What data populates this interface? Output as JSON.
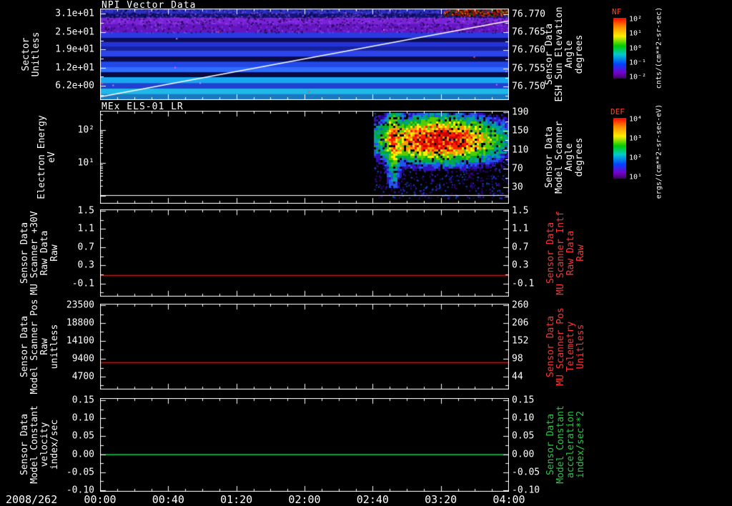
{
  "chart_data": [
    {
      "id": "npi-sector-spectrogram",
      "type": "heatmap",
      "title": "NPI Vector Data",
      "left_label": "Sector\nUnitless",
      "left_ticks": [
        {
          "label": "3.1e+01",
          "pos": 0.054
        },
        {
          "label": "2.5e+01",
          "pos": 0.254
        },
        {
          "label": "1.9e+01",
          "pos": 0.446
        },
        {
          "label": "1.2e+01",
          "pos": 0.646
        },
        {
          "label": "6.2e+00",
          "pos": 0.846
        }
      ],
      "right_label": "Sensor Data\nESH Sun Elevation\nAngle\ndegrees",
      "right_label_color": "#ffffff",
      "right_ticks": [
        {
          "label": "76.770",
          "pos": 0.06
        },
        {
          "label": "76.765",
          "pos": 0.26
        },
        {
          "label": "76.760",
          "pos": 0.454
        },
        {
          "label": "76.755",
          "pos": 0.654
        },
        {
          "label": "76.750",
          "pos": 0.854
        }
      ],
      "overlay_line": {
        "name": "ESH Sun Elevation Angle",
        "color": "#ffffff",
        "value_start": 76.748,
        "value_end": 76.77,
        "pos_start": 0.965,
        "pos_end": 0.135
      },
      "bands": [
        {
          "y0": 0.0,
          "y1": 0.055,
          "color": "#2830c0",
          "noise": true
        },
        {
          "y0": 0.055,
          "y1": 0.1,
          "color": "#141478",
          "noise": true
        },
        {
          "y0": 0.1,
          "y1": 0.17,
          "color": "#7a22d8",
          "noise": true
        },
        {
          "y0": 0.17,
          "y1": 0.26,
          "color": "#6414c0",
          "noise": true
        },
        {
          "y0": 0.26,
          "y1": 0.32,
          "color": "#2a3ae0",
          "noise": false
        },
        {
          "y0": 0.32,
          "y1": 0.365,
          "color": "#0c0c55",
          "noise": false
        },
        {
          "y0": 0.365,
          "y1": 0.415,
          "color": "#2334d6",
          "noise": false
        },
        {
          "y0": 0.415,
          "y1": 0.46,
          "color": "#18219c",
          "noise": false
        },
        {
          "y0": 0.46,
          "y1": 0.525,
          "color": "#2c44e8",
          "noise": false
        },
        {
          "y0": 0.525,
          "y1": 0.58,
          "color": "#0b0b46",
          "noise": false
        },
        {
          "y0": 0.58,
          "y1": 0.64,
          "color": "#2348e8",
          "noise": false
        },
        {
          "y0": 0.64,
          "y1": 0.695,
          "color": "#2f6cff",
          "noise": false
        },
        {
          "y0": 0.695,
          "y1": 0.75,
          "color": "#0a0a40",
          "noise": false
        },
        {
          "y0": 0.75,
          "y1": 0.815,
          "color": "#18a8f0",
          "noise": false
        },
        {
          "y0": 0.815,
          "y1": 0.875,
          "color": "#2040d0",
          "noise": false
        },
        {
          "y0": 0.875,
          "y1": 0.935,
          "color": "#20b8e8",
          "noise": false
        },
        {
          "y0": 0.935,
          "y1": 1.0,
          "color": "#1878c0",
          "noise": false
        }
      ],
      "hot_patch": {
        "x0": 0.84,
        "x1": 1.0,
        "y0": 0.005,
        "y1": 0.075
      },
      "seed": 11
    },
    {
      "id": "els-energy-spectrogram",
      "type": "heatmap",
      "title": "MEx ELS-01 LR",
      "left_label": "Electron Energy\neV",
      "log_left": true,
      "left_ticks": [
        {
          "label": "10²",
          "pos": 0.208
        },
        {
          "label": "10¹",
          "pos": 0.562
        }
      ],
      "right_label": "Sensor Data\nModel Scanner\nAngle\ndegrees",
      "right_label_color": "#ffffff",
      "right_ticks": [
        {
          "label": "190",
          "pos": 0.015
        },
        {
          "label": "150",
          "pos": 0.215
        },
        {
          "label": "110",
          "pos": 0.423
        },
        {
          "label": "70",
          "pos": 0.623
        },
        {
          "label": "30",
          "pos": 0.823
        }
      ],
      "blob": {
        "x0": 0.67,
        "cx": 0.83,
        "cy": 0.3,
        "sx": 0.105,
        "sy": 0.16,
        "streak_x": 0.715
      },
      "speckles": {
        "x0": 0.67,
        "n": 1100
      },
      "white_line_y": 0.905,
      "seed": 22
    },
    {
      "id": "mu-scanner-30v-raw",
      "type": "line",
      "title": "",
      "left_label": "Sensor Data\nMU Scanner +30V\nRaw Data\nRaw",
      "left_ticks": [
        {
          "label": "1.5",
          "pos": 0.017
        },
        {
          "label": "1.1",
          "pos": 0.225
        },
        {
          "label": "0.7",
          "pos": 0.433
        },
        {
          "label": "0.3",
          "pos": 0.642
        },
        {
          "label": "-0.1",
          "pos": 0.85
        }
      ],
      "right_label": "Sensor Data\nMU Scanner Intf\nRaw Data\nRaw",
      "right_label_color": "#ff3333",
      "right_ticks": [
        {
          "label": "1.5",
          "pos": 0.017
        },
        {
          "label": "1.1",
          "pos": 0.225
        },
        {
          "label": "0.7",
          "pos": 0.433
        },
        {
          "label": "0.3",
          "pos": 0.642
        },
        {
          "label": "-0.1",
          "pos": 0.85
        }
      ],
      "ylim": [
        -0.5,
        1.5
      ],
      "flat_line": {
        "value": 0.08,
        "color": "#ff0000",
        "pos": 0.754
      },
      "seed": 33
    },
    {
      "id": "model-scanner-pos-raw",
      "type": "line",
      "title": "",
      "left_label": "Sensor Data\nModel Scanner Pos\nRaw\nunitless",
      "left_ticks": [
        {
          "label": "23500",
          "pos": 0.017
        },
        {
          "label": "18800",
          "pos": 0.225
        },
        {
          "label": "14100",
          "pos": 0.433
        },
        {
          "label": "9400",
          "pos": 0.642
        },
        {
          "label": "4700",
          "pos": 0.85
        }
      ],
      "right_label": "Sensor Data\nMU Scanner Pos\nTelemetry\nUnitless",
      "right_label_color": "#ff3333",
      "right_ticks": [
        {
          "label": "260",
          "pos": 0.017
        },
        {
          "label": "206",
          "pos": 0.225
        },
        {
          "label": "152",
          "pos": 0.433
        },
        {
          "label": "98",
          "pos": 0.642
        },
        {
          "label": "44",
          "pos": 0.85
        }
      ],
      "ylim": [
        0,
        23500
      ],
      "flat_line": {
        "value": 8500,
        "color": "#ff0000",
        "pos": 0.683
      },
      "seed": 44
    },
    {
      "id": "model-constant-velocity",
      "type": "line",
      "title": "",
      "left_label": "Sensor Data\nModel Constant\nvelocity\nindex/sec",
      "left_ticks": [
        {
          "label": "0.15",
          "pos": 0.023
        },
        {
          "label": "0.10",
          "pos": 0.215
        },
        {
          "label": "0.05",
          "pos": 0.408
        },
        {
          "label": "0.00",
          "pos": 0.6
        },
        {
          "label": "-0.05",
          "pos": 0.793
        },
        {
          "label": "-0.10",
          "pos": 0.985
        }
      ],
      "right_label": "Sensor Data\nModel Constant\nacceleration\nindex/sec**2",
      "right_label_color": "#22cc44",
      "right_ticks": [
        {
          "label": "0.15",
          "pos": 0.023
        },
        {
          "label": "0.10",
          "pos": 0.215
        },
        {
          "label": "0.05",
          "pos": 0.408
        },
        {
          "label": "0.00",
          "pos": 0.6
        },
        {
          "label": "-0.05",
          "pos": 0.793
        },
        {
          "label": "-0.10",
          "pos": 0.985
        }
      ],
      "ylim": [
        -0.1,
        0.15
      ],
      "flat_line": {
        "value": 0.0,
        "color": "#00bb44",
        "pos": 0.6
      },
      "seed": 55
    }
  ],
  "colorbars": [
    {
      "title": "NF",
      "title_color": "#ff4422",
      "unit": "cnts/(cm**2-sr-sec)",
      "ticks": [
        {
          "label": "10²",
          "pos": 0.02
        },
        {
          "label": "10¹",
          "pos": 0.26
        },
        {
          "label": "10⁰",
          "pos": 0.5
        },
        {
          "label": "10⁻¹",
          "pos": 0.74
        },
        {
          "label": "10⁻²",
          "pos": 0.98
        }
      ]
    },
    {
      "title": "DEF",
      "title_color": "#ff4422",
      "unit": "ergs/(cm**2-sr-sec-eV)",
      "ticks": [
        {
          "label": "10⁴",
          "pos": 0.02
        },
        {
          "label": "10³",
          "pos": 0.34
        },
        {
          "label": "10²",
          "pos": 0.66
        },
        {
          "label": "10¹",
          "pos": 0.98
        }
      ]
    }
  ],
  "xaxis": {
    "date": "2008/262",
    "ticks": [
      {
        "label": "00:00",
        "pos": 0.0
      },
      {
        "label": "00:40",
        "pos": 0.1667
      },
      {
        "label": "01:20",
        "pos": 0.3333
      },
      {
        "label": "02:00",
        "pos": 0.5
      },
      {
        "label": "02:40",
        "pos": 0.6667
      },
      {
        "label": "03:20",
        "pos": 0.8333
      },
      {
        "label": "04:00",
        "pos": 1.0
      }
    ]
  }
}
